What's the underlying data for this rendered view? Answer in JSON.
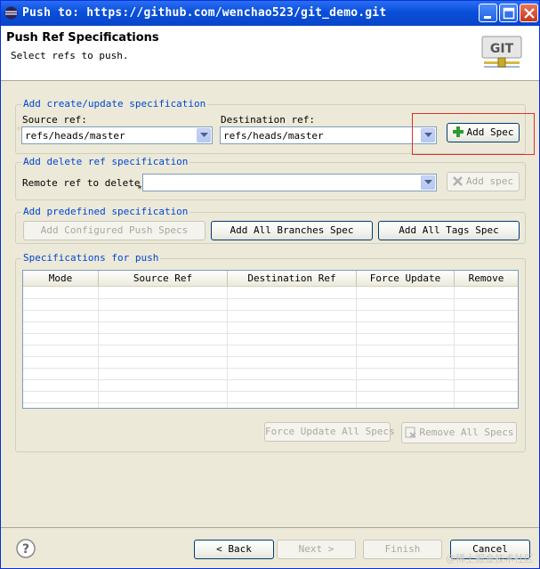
{
  "window": {
    "title": "Push to: https://github.com/wenchao523/git_demo.git"
  },
  "header": {
    "title": "Push Ref Specifications",
    "subtitle": "Select refs to push.",
    "logo_text": "GIT"
  },
  "create_group": {
    "legend": "Add create/update specification",
    "source_label": "Source ref:",
    "source_value": "refs/heads/master",
    "dest_label": "Destination ref:",
    "dest_value": "refs/heads/master",
    "add_button": "Add Spec"
  },
  "delete_group": {
    "legend": "Add delete ref specification",
    "remote_label": "Remote ref to delete:",
    "remote_value": "",
    "add_button": "Add spec"
  },
  "predefined_group": {
    "legend": "Add predefined specification",
    "configured_button": "Add Configured Push Specs",
    "all_branches_button": "Add All Branches Spec",
    "all_tags_button": "Add All Tags Spec"
  },
  "specs_group": {
    "legend": "Specifications for push",
    "columns": [
      "Mode",
      "Source Ref",
      "Destination Ref",
      "Force Update",
      "Remove"
    ],
    "rows": [],
    "force_update_all_button": "Force Update All Specs",
    "remove_all_button": "Remove All Specs"
  },
  "footer": {
    "back_button": "< Back",
    "next_button": "Next >",
    "finish_button": "Finish",
    "cancel_button": "Cancel",
    "watermark": "@稀土掘金技术社区"
  },
  "colors": {
    "title_bar": "#0a4fd9",
    "group_legend": "#0046d5",
    "highlight_box": "#e0302b"
  }
}
